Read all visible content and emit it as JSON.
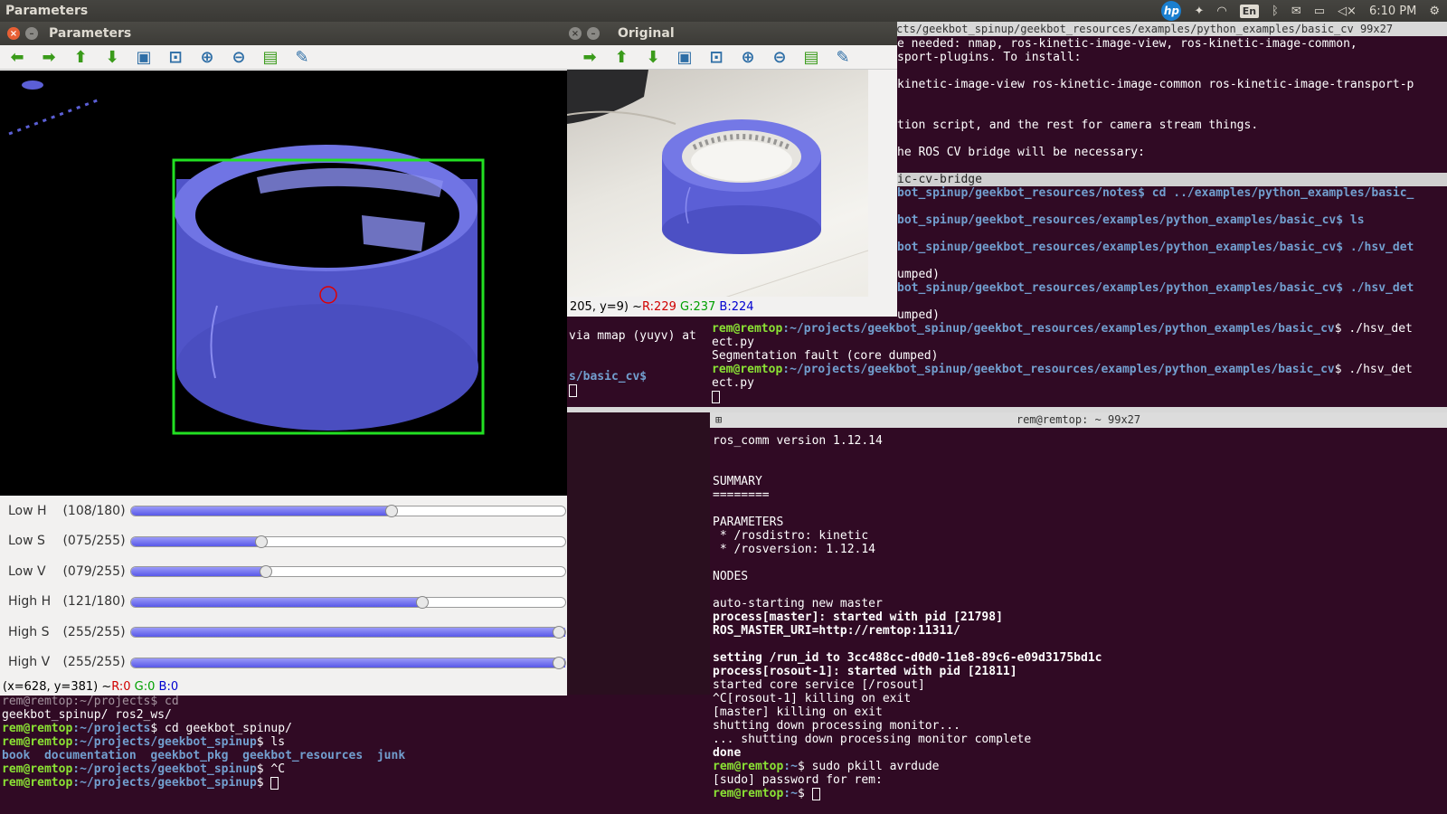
{
  "topbar": {
    "app_title": "Parameters",
    "lang": "En",
    "clock": "6:10 PM",
    "hp_logo": "hp",
    "icons": [
      "hp-icon",
      "dropbox-icon",
      "wifi-icon",
      "keyboard-lang-icon",
      "bluetooth-icon",
      "mail-icon",
      "battery-icon",
      "volume-icon",
      "gear-icon"
    ]
  },
  "term_top_right": {
    "title_fragment": "cts/geekbot_spinup/geekbot_resources/examples/python_examples/basic_cv 99x27",
    "lines": [
      "e needed: nmap, ros-kinetic-image-view, ros-kinetic-image-common,",
      "sport-plugins. To install:",
      "",
      "kinetic-image-view ros-kinetic-image-common ros-kinetic-image-transport-p",
      "",
      "",
      "tion script, and the rest for camera stream things.",
      "",
      "he ROS CV bridge will be necessary:",
      "",
      "ic-cv-bridge",
      "bot_spinup/geekbot_resources/notes$ cd ../examples/python_examples/basic_",
      "",
      "bot_spinup/geekbot_resources/examples/python_examples/basic_cv$ ls",
      "",
      "bot_spinup/geekbot_resources/examples/python_examples/basic_cv$ ./hsv_det",
      "",
      "umped)",
      "bot_spinup/geekbot_resources/examples/python_examples/basic_cv$ ./hsv_det",
      "",
      "umped)"
    ],
    "prompt_user": "rem@remtop",
    "prompt_path": ":~/projects/geekbot_spinup/geekbot_resources/examples/python_examples/basic_cv",
    "cmd": "$ ./hsv_det",
    "cont": "ect.py",
    "segfault": "Segmentation fault (core dumped)"
  },
  "term_middle": {
    "lines": [
      "via mmap (yuyv) at",
      "",
      "",
      "s/basic_cv$ "
    ]
  },
  "term_bottom_right": {
    "title": "rem@remtop: ~ 99x27",
    "lines": [
      {
        "t": "ros_comm version 1.12.14",
        "s": "n"
      },
      {
        "t": "",
        "s": "n"
      },
      {
        "t": "",
        "s": "n"
      },
      {
        "t": "SUMMARY",
        "s": "n"
      },
      {
        "t": "========",
        "s": "n"
      },
      {
        "t": "",
        "s": "n"
      },
      {
        "t": "PARAMETERS",
        "s": "n"
      },
      {
        "t": " * /rosdistro: kinetic",
        "s": "n"
      },
      {
        "t": " * /rosversion: 1.12.14",
        "s": "n"
      },
      {
        "t": "",
        "s": "n"
      },
      {
        "t": "NODES",
        "s": "n"
      },
      {
        "t": "",
        "s": "n"
      },
      {
        "t": "auto-starting new master",
        "s": "n"
      },
      {
        "t": "process[master]: started with pid [21798]",
        "s": "b"
      },
      {
        "t": "ROS_MASTER_URI=http://remtop:11311/",
        "s": "b"
      },
      {
        "t": "",
        "s": "n"
      },
      {
        "t": "setting /run_id to 3cc488cc-d0d0-11e8-89c6-e09d3175bd1c",
        "s": "b"
      },
      {
        "t": "process[rosout-1]: started with pid [21811]",
        "s": "b"
      },
      {
        "t": "started core service [/rosout]",
        "s": "n"
      },
      {
        "t": "^C[rosout-1] killing on exit",
        "s": "n"
      },
      {
        "t": "[master] killing on exit",
        "s": "n"
      },
      {
        "t": "shutting down processing monitor...",
        "s": "n"
      },
      {
        "t": "... shutting down processing monitor complete",
        "s": "n"
      },
      {
        "t": "done",
        "s": "b"
      }
    ],
    "prompt_user": "rem@remtop",
    "prompt_path": ":~",
    "cmd1": "$ sudo pkill avrdude",
    "sudo": "[sudo] password for rem:",
    "cmd2": "$ "
  },
  "term_bottom_left": {
    "line0": "rem@remtop:~/projects$ cd",
    "line1": "geekbot_spinup/ ros2_ws/",
    "prompt_user": "rem@remtop",
    "path1": ":~/projects",
    "cmd1": "$ cd geekbot_spinup/",
    "path2": ":~/projects/geekbot_spinup",
    "cmd2": "$ ls",
    "ls": [
      "book",
      "documentation",
      "geekbot_pkg",
      "geekbot_resources",
      "junk"
    ],
    "cmd3": "$ ^C",
    "cmd4": "$ "
  },
  "parameters_window": {
    "title": "Parameters",
    "status_coords": "(x=628, y=381) ~ ",
    "status_r": "R:0",
    "status_g": "G:0",
    "status_b": "B:0",
    "sliders": [
      {
        "label": "Low H",
        "value": "(108/180)",
        "fraction": 0.6
      },
      {
        "label": "Low S",
        "value": "(075/255)",
        "fraction": 0.3
      },
      {
        "label": "Low V",
        "value": "(079/255)",
        "fraction": 0.31
      },
      {
        "label": "High H",
        "value": "(121/180)",
        "fraction": 0.67
      },
      {
        "label": "High S",
        "value": "(255/255)",
        "fraction": 1.0
      },
      {
        "label": "High V",
        "value": "(255/255)",
        "fraction": 1.0
      }
    ],
    "toolbar": [
      "arrow-left-icon",
      "arrow-right-icon",
      "arrow-up-icon",
      "arrow-down-icon",
      "image-icon",
      "zoom-fit-icon",
      "zoom-in-icon",
      "zoom-out-icon",
      "save-icon",
      "brush-icon"
    ]
  },
  "original_window": {
    "title": "Original",
    "status_coords": "205, y=9) ~ ",
    "status_r": "R:229",
    "status_g": "G:237",
    "status_b": "B:224"
  },
  "colors": {
    "terminal_bg": "#300a24",
    "prompt_green": "#8ae234",
    "path_blue": "#729fcf",
    "tape_blue": "#5b5fd6",
    "bbox_green": "#22e022"
  }
}
